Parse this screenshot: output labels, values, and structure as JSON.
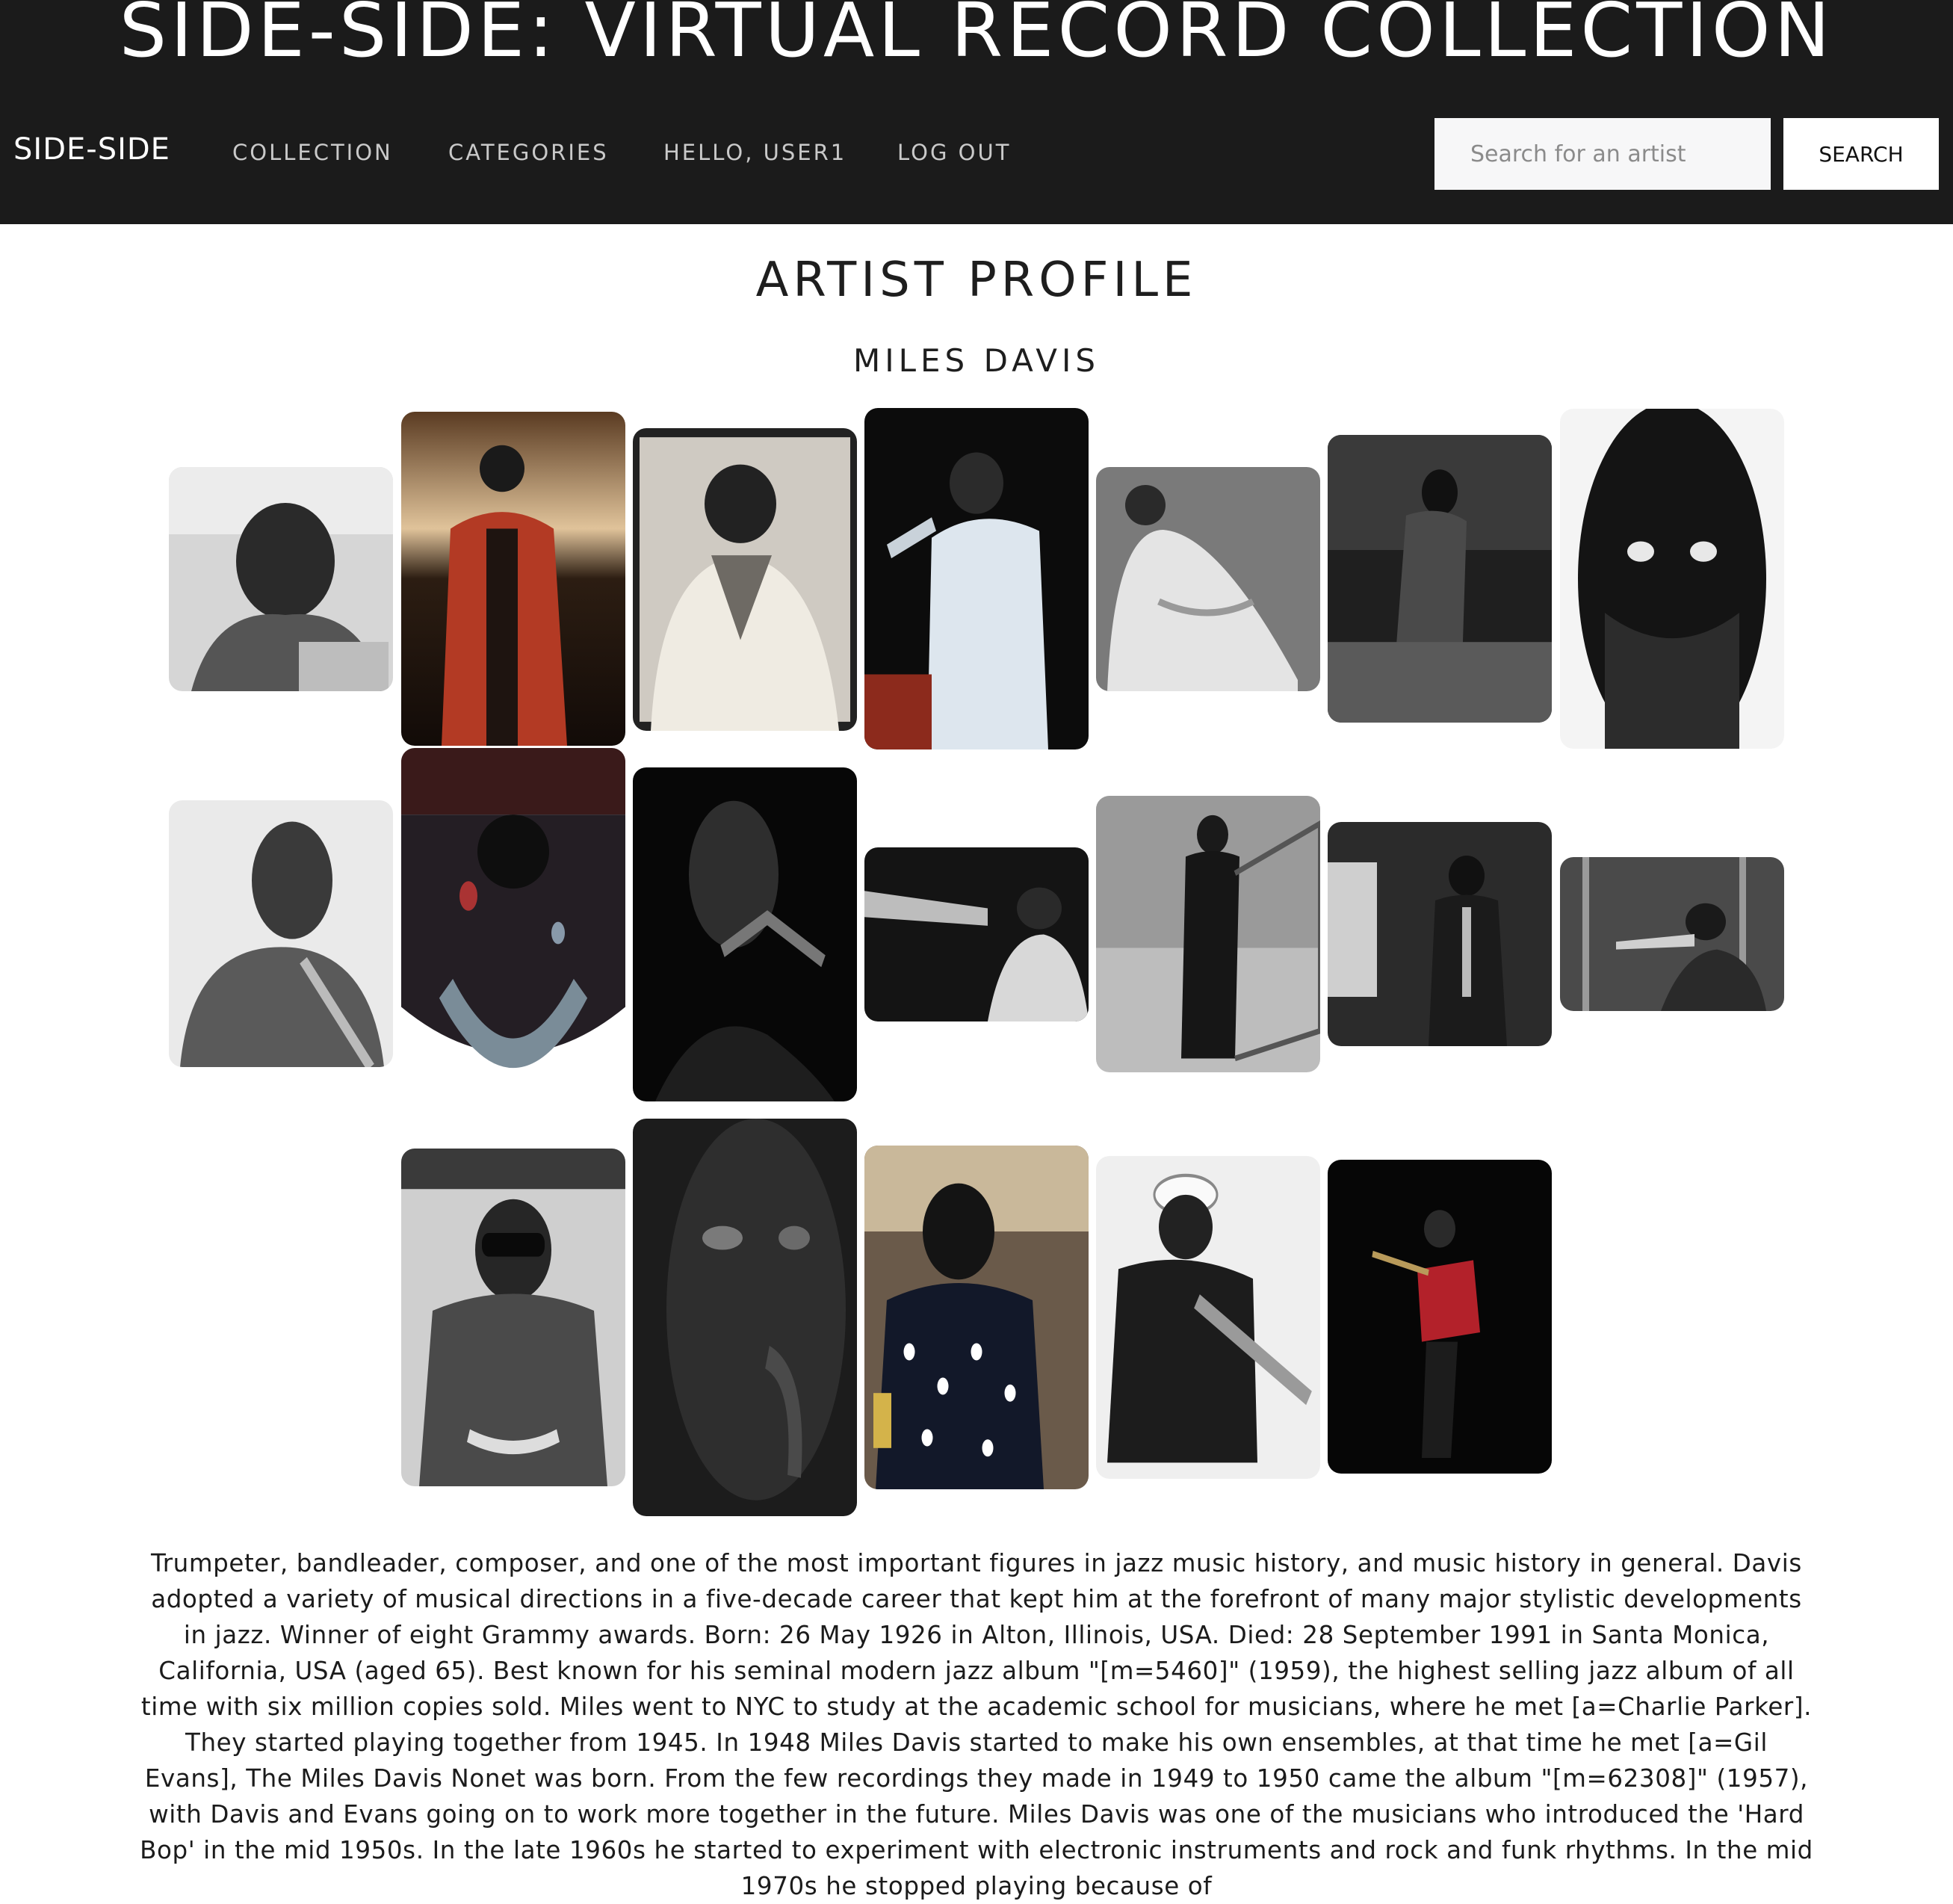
{
  "header": {
    "site_title": "SIDE-SIDE: VIRTUAL RECORD COLLECTION",
    "brand": "SIDE-SIDE",
    "nav": [
      {
        "label": "COLLECTION"
      },
      {
        "label": "CATEGORIES"
      },
      {
        "label": "HELLO, USER1"
      },
      {
        "label": "LOG OUT"
      }
    ],
    "search": {
      "placeholder": "Search for an artist",
      "value": "",
      "button_label": "SEARCH"
    }
  },
  "main": {
    "heading": "ARTIST PROFILE",
    "artist_name": "MILES DAVIS",
    "photo_count": 19,
    "bio": "Trumpeter, bandleader, composer, and one of the most important figures in jazz music history, and music history in general. Davis adopted a variety of musical directions in a five-decade career that kept him at the forefront of many major stylistic developments in jazz. Winner of eight Grammy awards. Born: 26 May 1926 in Alton, Illinois, USA. Died: 28 September 1991 in Santa Monica, California, USA (aged 65). Best known for his seminal modern jazz album \"[m=5460]\" (1959), the highest selling jazz album of all time with six million copies sold. Miles went to NYC to study at the academic school for musicians, where he met [a=Charlie Parker]. They started playing together from 1945. In 1948 Miles Davis started to make his own ensembles, at that time he met [a=Gil Evans], The Miles Davis Nonet was born. From the few recordings they made in 1949 to 1950 came the album \"[m=62308]\" (1957), with Davis and Evans going on to work more together in the future. Miles Davis was one of the musicians who introduced the 'Hard Bop' in the mid 1950s. In the late 1960s he started to experiment with electronic instruments and rock and funk rhythms. In the mid 1970s he stopped playing because of"
  },
  "colors": {
    "header_bg": "#1b1b1b",
    "nav_text": "#c9c9c9",
    "page_bg": "#ffffff",
    "text": "#1e1e1e"
  }
}
